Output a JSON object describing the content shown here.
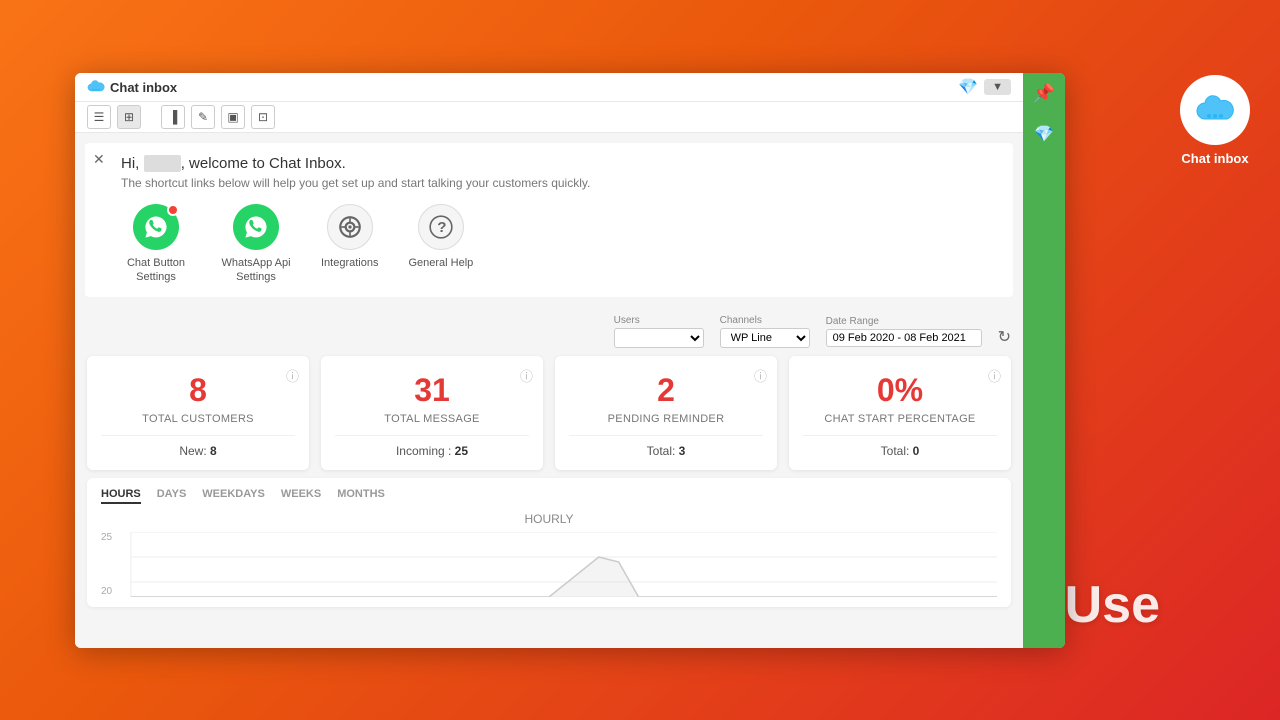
{
  "app": {
    "title": "Chat inbox",
    "logo_alt": "chat-inbox-logo"
  },
  "sidebar_icon": {
    "label": "Chat\nInbox"
  },
  "welcome": {
    "greeting": "Hi,",
    "username_placeholder": "User",
    "message": ", welcome to Chat Inbox.",
    "sub": "The shortcut links below will help you get set up and start talking your customers quickly."
  },
  "quick_links": [
    {
      "id": "chat-button-settings",
      "label": "Chat Button Settings",
      "icon": "whatsapp"
    },
    {
      "id": "whatsapp-api-settings",
      "label": "WhatsApp Api Settings",
      "icon": "whatsapp-api"
    },
    {
      "id": "integrations",
      "label": "Integrations",
      "icon": "gear"
    },
    {
      "id": "general-help",
      "label": "General Help",
      "icon": "help"
    }
  ],
  "filters": {
    "users_label": "Users",
    "users_value": "",
    "channels_label": "Channels",
    "channels_value": "WP Line",
    "date_range_label": "Date Range",
    "date_range_value": "09 Feb 2020 - 08 Feb 2021"
  },
  "stats": [
    {
      "id": "total-customers",
      "value": "8",
      "name": "TOTAL CUSTOMERS",
      "sub_label": "New:",
      "sub_value": "8"
    },
    {
      "id": "total-message",
      "value": "31",
      "name": "TOTAL MESSAGE",
      "sub_label": "Incoming :",
      "sub_value": "25"
    },
    {
      "id": "pending-reminder",
      "value": "2",
      "name": "PENDING REMINDER",
      "sub_label": "Total:",
      "sub_value": "3"
    },
    {
      "id": "chat-start-percentage",
      "value": "0%",
      "name": "CHAT START PERCENTAGE",
      "sub_label": "Total:",
      "sub_value": "0"
    }
  ],
  "chart": {
    "tabs": [
      "HOURS",
      "DAYS",
      "WEEKDAYS",
      "WEEKS",
      "MONTHS"
    ],
    "active_tab": "HOURS",
    "title": "HOURLY",
    "y_labels": [
      "25",
      "20"
    ],
    "info_text": "ⓘ"
  },
  "toolbar": {
    "icons": [
      "⊞",
      "⊟",
      "📊",
      "✏️",
      "🖼",
      "⊡"
    ]
  },
  "overlay_text": "Easy to Use"
}
